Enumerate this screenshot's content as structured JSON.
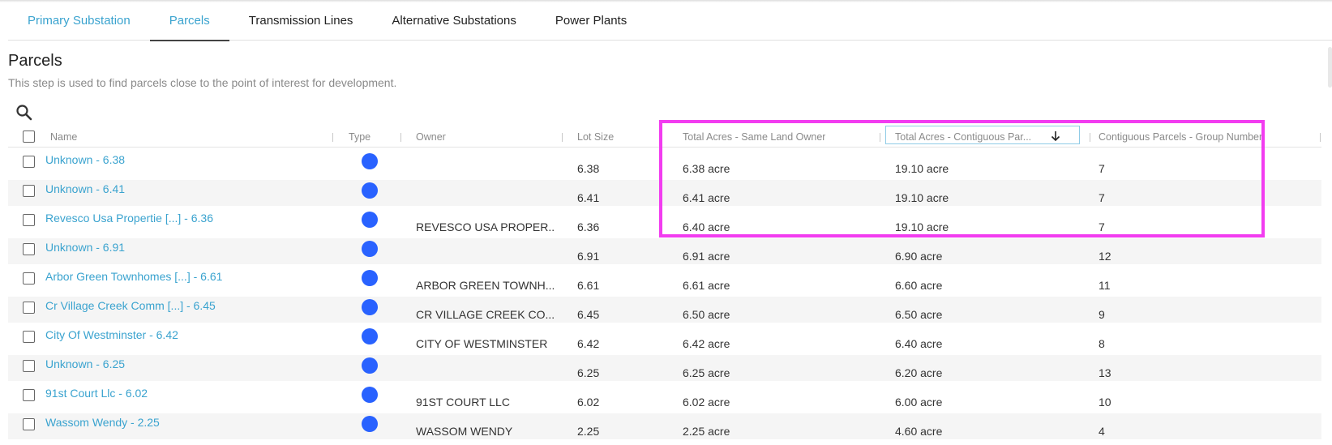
{
  "tabs": [
    {
      "label": "Primary Substation"
    },
    {
      "label": "Parcels"
    },
    {
      "label": "Transmission Lines"
    },
    {
      "label": "Alternative Substations"
    },
    {
      "label": "Power Plants"
    }
  ],
  "page": {
    "title": "Parcels",
    "description": "This step is used to find parcels close to the point of interest for development."
  },
  "icons": {
    "search": "search-icon",
    "sort": "arrow-down-icon",
    "type_marker": "blue-dot"
  },
  "colors": {
    "accent": "#3aa3cf",
    "type_dot": "#2962ff",
    "highlight": "#f23cf0"
  },
  "table": {
    "columns": [
      "Name",
      "Type",
      "Owner",
      "Lot Size",
      "Total Acres - Same Land Owner",
      "Total Acres - Contiguous Par...",
      "Contiguous Parcels - Group Number"
    ],
    "sorted_column": "Total Acres - Contiguous Par...",
    "sort_direction": "descending",
    "rows": [
      {
        "name": "Unknown - 6.38",
        "owner": "",
        "lot": "6.38",
        "same": "6.38 acre",
        "contig": "19.10 acre",
        "group": "7"
      },
      {
        "name": "Unknown - 6.41",
        "owner": "",
        "lot": "6.41",
        "same": "6.41 acre",
        "contig": "19.10 acre",
        "group": "7"
      },
      {
        "name": "Revesco Usa Propertie [...] - 6.36",
        "owner": "REVESCO USA PROPER...",
        "lot": "6.36",
        "same": "6.40 acre",
        "contig": "19.10 acre",
        "group": "7"
      },
      {
        "name": "Unknown - 6.91",
        "owner": "",
        "lot": "6.91",
        "same": "6.91 acre",
        "contig": "6.90 acre",
        "group": "12"
      },
      {
        "name": "Arbor Green Townhomes [...] - 6.61",
        "owner": "ARBOR GREEN TOWNH...",
        "lot": "6.61",
        "same": "6.61 acre",
        "contig": "6.60 acre",
        "group": "11"
      },
      {
        "name": "Cr Village Creek Comm [...] - 6.45",
        "owner": "CR VILLAGE CREEK CO...",
        "lot": "6.45",
        "same": "6.50 acre",
        "contig": "6.50 acre",
        "group": "9"
      },
      {
        "name": "City Of Westminster - 6.42",
        "owner": "CITY OF WESTMINSTER",
        "lot": "6.42",
        "same": "6.42 acre",
        "contig": "6.40 acre",
        "group": "8"
      },
      {
        "name": "Unknown - 6.25",
        "owner": "",
        "lot": "6.25",
        "same": "6.25 acre",
        "contig": "6.20 acre",
        "group": "13"
      },
      {
        "name": "91st Court Llc - 6.02",
        "owner": "91ST COURT LLC",
        "lot": "6.02",
        "same": "6.02 acre",
        "contig": "6.00 acre",
        "group": "10"
      },
      {
        "name": "Wassom Wendy - 2.25",
        "owner": "WASSOM WENDY",
        "lot": "2.25",
        "same": "2.25 acre",
        "contig": "4.60 acre",
        "group": "4"
      }
    ]
  }
}
